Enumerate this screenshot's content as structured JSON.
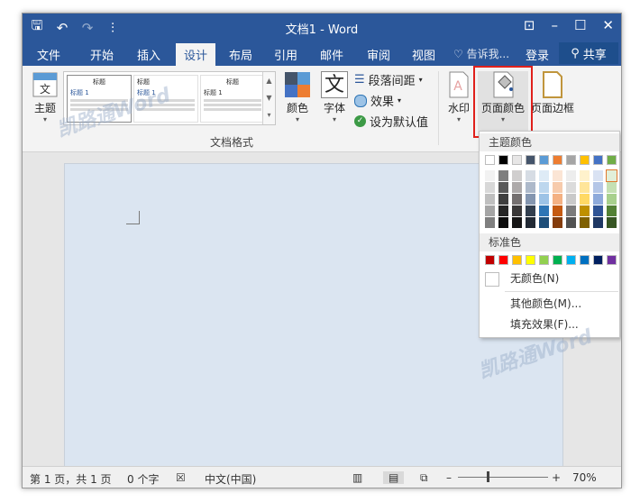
{
  "window": {
    "title": "文档1 - Word",
    "controls": {
      "restore": "⊡",
      "minimize": "–",
      "maximize": "☐",
      "close": "✕"
    }
  },
  "quick_access": {
    "save": "🖫",
    "undo": "↶",
    "redo": "↷",
    "customize": "⫶"
  },
  "tabs": [
    {
      "label": "文件",
      "active": false
    },
    {
      "label": "开始",
      "active": false
    },
    {
      "label": "插入",
      "active": false
    },
    {
      "label": "设计",
      "active": true
    },
    {
      "label": "布局",
      "active": false
    },
    {
      "label": "引用",
      "active": false
    },
    {
      "label": "邮件",
      "active": false
    },
    {
      "label": "审阅",
      "active": false
    },
    {
      "label": "视图",
      "active": false
    }
  ],
  "tell_me": "告诉我...",
  "login": "登录",
  "share": "共享",
  "ribbon": {
    "theme": "主题",
    "gallery": {
      "thumb1_title": "标题",
      "thumb1_heading": "标题 1",
      "thumb2_title": "标题",
      "thumb2_heading": "标题 1",
      "thumb3_title": "标题",
      "thumb3_heading": "标题 1"
    },
    "colors": "颜色",
    "fonts": "字体",
    "fonts_glyph": "文",
    "paragraph_spacing": "段落间距",
    "effects": "效果",
    "set_default": "设为默认值",
    "group_document_format": "文档格式",
    "watermark": "水印",
    "page_color": "页面颜色",
    "page_borders": "页面边框"
  },
  "dropdown": {
    "theme_colors_label": "主题颜色",
    "standard_colors_label": "标准色",
    "no_color": "无颜色(N)",
    "more_colors": "其他颜色(M)...",
    "fill_effects": "填充效果(F)...",
    "theme_top_row": [
      "#ffffff",
      "#000000",
      "#e7e6e6",
      "#44546a",
      "#5b9bd5",
      "#ed7d31",
      "#a5a5a5",
      "#ffc000",
      "#4472c4",
      "#70ad47"
    ],
    "theme_shades": [
      [
        "#f2f2f2",
        "#7f7f7f",
        "#d0cece",
        "#d6dce4",
        "#deebf6",
        "#fbe5d5",
        "#ededed",
        "#fff2cc",
        "#d9e2f3",
        "#e2efd9"
      ],
      [
        "#d8d8d8",
        "#595959",
        "#aeaaaa",
        "#adb9ca",
        "#bdd7ee",
        "#f7cbac",
        "#dbdbdb",
        "#ffe599",
        "#b4c6e7",
        "#c5e0b3"
      ],
      [
        "#bfbfbf",
        "#3f3f3f",
        "#757070",
        "#8496b0",
        "#9dc3e6",
        "#f4b183",
        "#c9c9c9",
        "#ffd965",
        "#8eaadb",
        "#a8d08d"
      ],
      [
        "#a5a5a5",
        "#262626",
        "#3a3838",
        "#323f4f",
        "#2e75b5",
        "#c55a11",
        "#7b7b7b",
        "#bf9000",
        "#2f5496",
        "#538135"
      ],
      [
        "#7f7f7f",
        "#0c0c0c",
        "#171616",
        "#222a35",
        "#1e4e79",
        "#843c0b",
        "#525252",
        "#7f6000",
        "#1f3864",
        "#375623"
      ]
    ],
    "standard": [
      "#c00000",
      "#ff0000",
      "#ffc000",
      "#ffff00",
      "#92d050",
      "#00b050",
      "#00b0f0",
      "#0070c0",
      "#002060",
      "#7030a0"
    ]
  },
  "status": {
    "page": "第 1 页，共 1 页",
    "words": "0 个字",
    "language": "中文(中国)",
    "zoom_minus": "–",
    "zoom_plus": "+",
    "zoom": "70%"
  },
  "watermark_text": "凯路通Word",
  "colors": {
    "titlebar": "#2b579a",
    "highlight": "#e0201b",
    "page_bg": "#dbe5f1"
  }
}
